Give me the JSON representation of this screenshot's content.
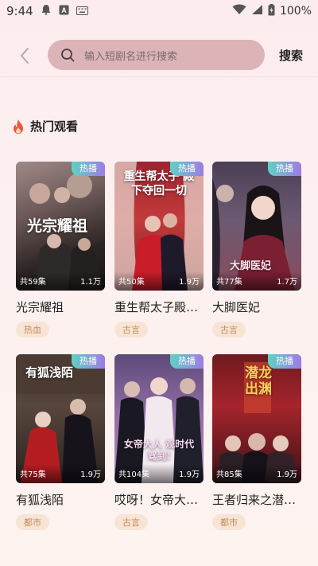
{
  "status": {
    "time": "9:44",
    "battery": "100%"
  },
  "header": {
    "search_placeholder": "输入短剧名进行搜索",
    "search_button": "搜索"
  },
  "section": {
    "title": "热门观看"
  },
  "badge_label": "热播",
  "colors": {
    "badge_start": "#5fd1c3",
    "badge_end": "#9f7be6",
    "tag_text": "#c48a5a",
    "tag_bg": "#f7e4d4",
    "search_bg": "#dcb4b8"
  },
  "cards": [
    {
      "title": "光宗耀祖",
      "tag": "热血",
      "episodes": "共59集",
      "views": "1.1万",
      "poster_text": "光宗耀祖"
    },
    {
      "title": "重生帮太子殿…",
      "tag": "古言",
      "episodes": "共50集",
      "views": "1.9万",
      "poster_text": "重生帮太子 殿下夺回一切"
    },
    {
      "title": "大脚医妃",
      "tag": "古言",
      "episodes": "共77集",
      "views": "1.7万",
      "poster_text": "大脚医妃"
    },
    {
      "title": "有狐浅陌",
      "tag": "都市",
      "episodes": "共75集",
      "views": "1.9万",
      "poster_text": "有狐浅陌"
    },
    {
      "title": "哎呀！女帝大…",
      "tag": "古言",
      "episodes": "共104集",
      "views": "1.9万",
      "poster_text": "女帝大人 观时代驾到!"
    },
    {
      "title": "王者归来之潜…",
      "tag": "都市",
      "episodes": "共85集",
      "views": "1.9万",
      "poster_text": "潜龙出渊"
    }
  ]
}
